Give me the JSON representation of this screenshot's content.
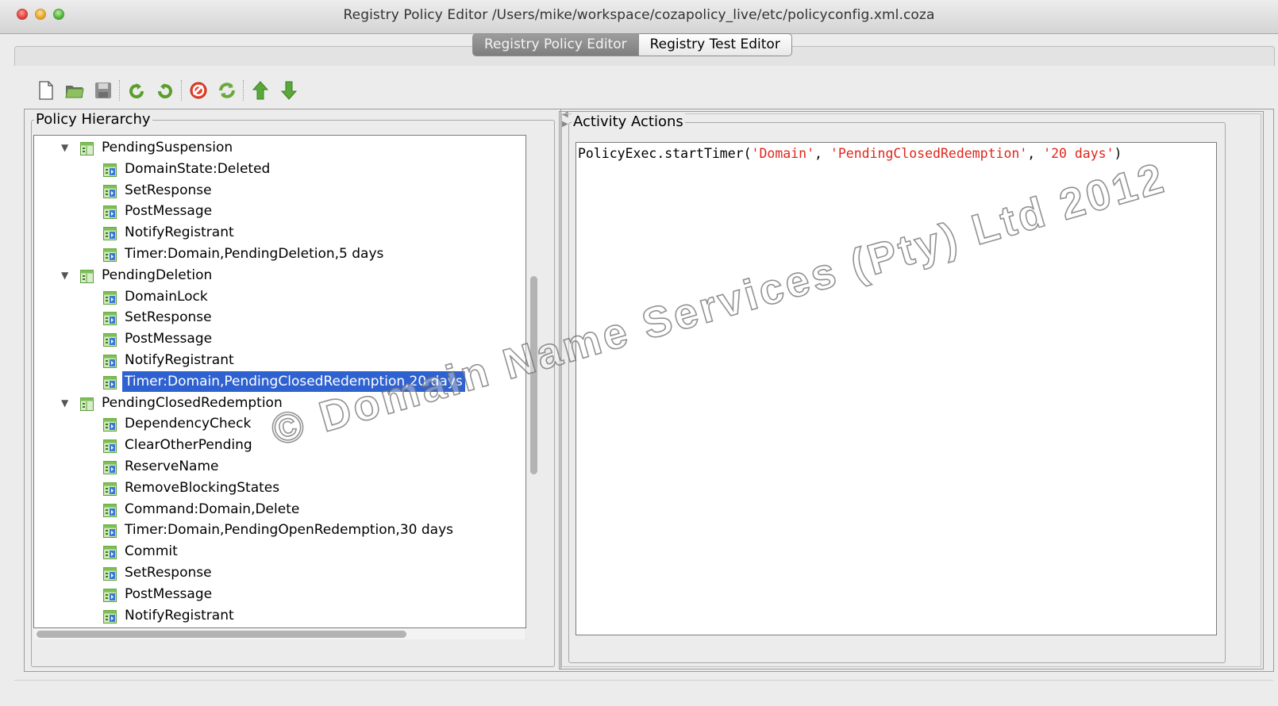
{
  "window": {
    "title": "Registry Policy Editor /Users/mike/workspace/cozapolicy_live/etc/policyconfig.xml.coza"
  },
  "tabs": [
    {
      "label": "Registry Policy Editor",
      "active": true
    },
    {
      "label": "Registry Test Editor",
      "active": false
    }
  ],
  "toolbar": {
    "icons": [
      "new-document-icon",
      "open-folder-icon",
      "save-icon",
      "undo-icon",
      "redo-icon",
      "stop-icon",
      "refresh-icon",
      "move-up-icon",
      "move-down-icon"
    ]
  },
  "policy_hierarchy": {
    "title": "Policy Hierarchy",
    "groups": [
      {
        "label": "PendingSuspension",
        "children": [
          "DomainState:Deleted",
          "SetResponse",
          "PostMessage",
          "NotifyRegistrant",
          "Timer:Domain,PendingDeletion,5 days"
        ]
      },
      {
        "label": "PendingDeletion",
        "children": [
          "DomainLock",
          "SetResponse",
          "PostMessage",
          "NotifyRegistrant",
          "Timer:Domain,PendingClosedRedemption,20 days"
        ]
      },
      {
        "label": "PendingClosedRedemption",
        "children": [
          "DependencyCheck",
          "ClearOtherPending",
          "ReserveName",
          "RemoveBlockingStates",
          "Command:Domain,Delete",
          "Timer:Domain,PendingOpenRedemption,30 days",
          "Commit",
          "SetResponse",
          "PostMessage",
          "NotifyRegistrant"
        ]
      }
    ],
    "selected": "Timer:Domain,PendingClosedRedemption,20 days"
  },
  "activity_actions": {
    "title": "Activity Actions",
    "code_prefix": "PolicyExec.startTimer(",
    "args": [
      "'Domain'",
      "'PendingClosedRedemption'",
      "'20 days'"
    ],
    "code_suffix": ")"
  },
  "watermark": "© Domain Name Services (Pty) Ltd 2012",
  "colors": {
    "selection": "#2f62d1",
    "code_string": "#e0261b",
    "group_icon": "#5a9e3a",
    "leaf_icon": "#3a7bd5"
  }
}
